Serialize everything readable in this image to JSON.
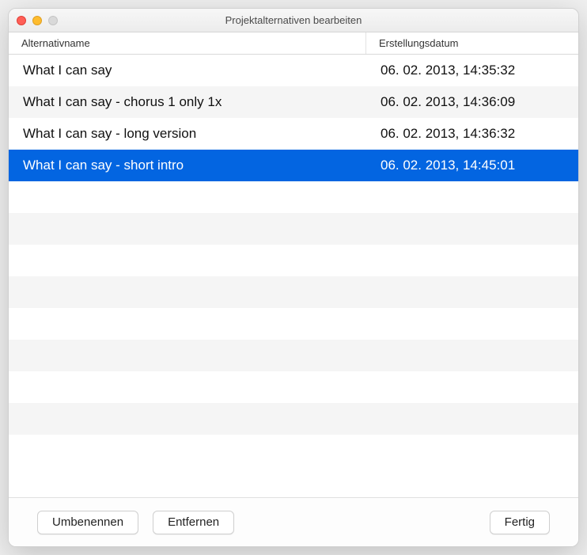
{
  "window": {
    "title": "Projektalternativen bearbeiten"
  },
  "headers": {
    "name": "Alternativname",
    "date": "Erstellungsdatum"
  },
  "rows": [
    {
      "name": "What I can say",
      "date": "06. 02. 2013, 14:35:32",
      "selected": false
    },
    {
      "name": "What I can say - chorus 1 only 1x",
      "date": "06. 02. 2013, 14:36:09",
      "selected": false
    },
    {
      "name": "What I can say - long version",
      "date": "06. 02. 2013, 14:36:32",
      "selected": false
    },
    {
      "name": "What I can say - short intro",
      "date": "06. 02. 2013, 14:45:01",
      "selected": true
    }
  ],
  "buttons": {
    "rename": "Umbenennen",
    "remove": "Entfernen",
    "done": "Fertig"
  }
}
